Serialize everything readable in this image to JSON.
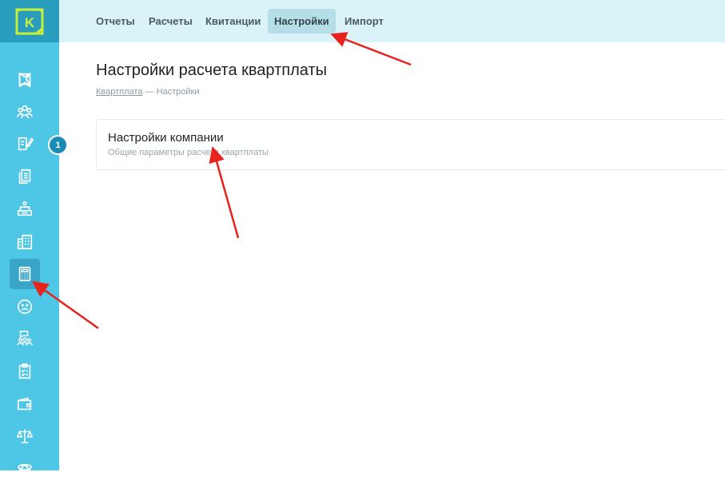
{
  "logo": {
    "letter": "K"
  },
  "sidebar": {
    "icons": [
      "flag-icon",
      "users-group-icon",
      "edit-document-icon",
      "documents-icon",
      "cashier-icon",
      "buildings-icon",
      "calculator-icon",
      "sad-face-icon",
      "people-chat-icon",
      "checklist-icon",
      "wallet-icon",
      "scales-icon",
      "phone-icon"
    ],
    "active": "calculator-icon",
    "badge": "1"
  },
  "tabs": [
    {
      "label": "Отчеты",
      "active": false
    },
    {
      "label": "Расчеты",
      "active": false
    },
    {
      "label": "Квитанции",
      "active": false
    },
    {
      "label": "Настройки",
      "active": true
    },
    {
      "label": "Импорт",
      "active": false
    }
  ],
  "page": {
    "title": "Настройки расчета квартплаты",
    "breadcrumb": {
      "link": "Квартплата",
      "separator": "—",
      "current": "Настройки"
    }
  },
  "card": {
    "title": "Настройки компании",
    "subtitle": "Общие параметры расчета квартплаты"
  },
  "colors": {
    "sidebar": "#4ec6e6",
    "logo_bg": "#2b9dbc",
    "topbar": "#d9f3f9",
    "active_tab": "#b4dfe9",
    "badge": "#1b8bb5",
    "annotation_arrow": "#e8221c"
  }
}
